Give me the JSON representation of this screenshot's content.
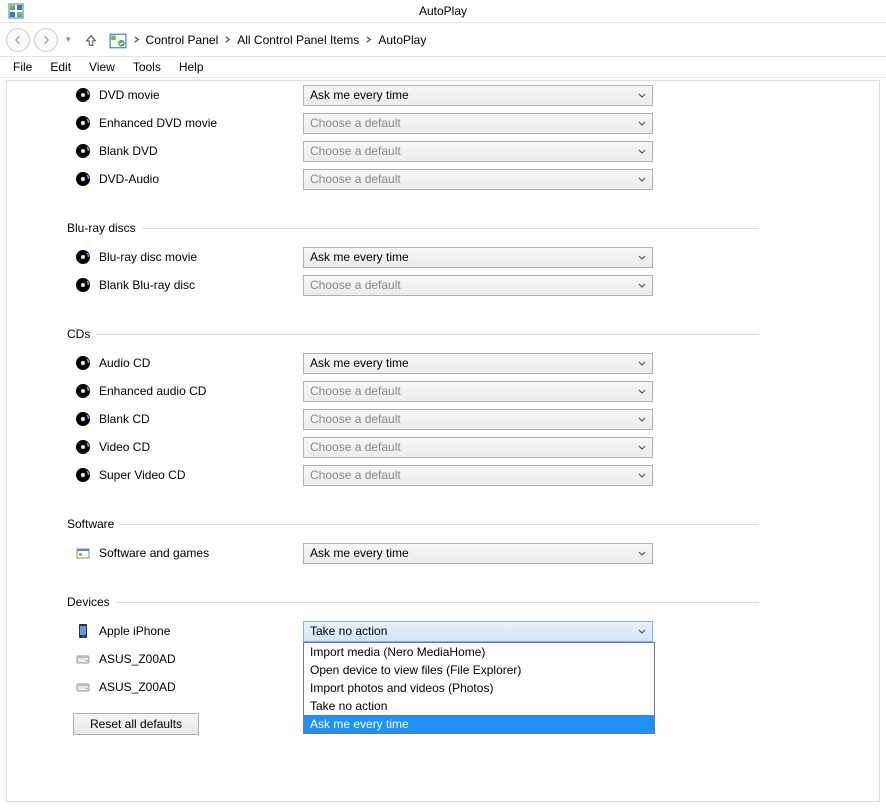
{
  "window": {
    "title": "AutoPlay"
  },
  "breadcrumb": [
    "Control Panel",
    "All Control Panel Items",
    "AutoPlay"
  ],
  "menus": [
    "File",
    "Edit",
    "View",
    "Tools",
    "Help"
  ],
  "dropdown_values": {
    "ask": "Ask me every time",
    "choose": "Choose a default",
    "take_none": "Take no action"
  },
  "sections": [
    {
      "title": null,
      "items": [
        {
          "label": "DVD movie",
          "value": "ask",
          "enabled": true,
          "icon": "disc"
        },
        {
          "label": "Enhanced DVD movie",
          "value": "choose",
          "enabled": false,
          "icon": "disc"
        },
        {
          "label": "Blank DVD",
          "value": "choose",
          "enabled": false,
          "icon": "disc"
        },
        {
          "label": "DVD-Audio",
          "value": "choose",
          "enabled": false,
          "icon": "disc"
        }
      ]
    },
    {
      "title": "Blu-ray discs",
      "items": [
        {
          "label": "Blu-ray disc movie",
          "value": "ask",
          "enabled": true,
          "icon": "disc"
        },
        {
          "label": "Blank Blu-ray disc",
          "value": "choose",
          "enabled": false,
          "icon": "disc"
        }
      ]
    },
    {
      "title": "CDs",
      "items": [
        {
          "label": "Audio CD",
          "value": "ask",
          "enabled": true,
          "icon": "disc"
        },
        {
          "label": "Enhanced audio CD",
          "value": "choose",
          "enabled": false,
          "icon": "disc"
        },
        {
          "label": "Blank CD",
          "value": "choose",
          "enabled": false,
          "icon": "disc"
        },
        {
          "label": "Video CD",
          "value": "choose",
          "enabled": false,
          "icon": "disc"
        },
        {
          "label": "Super Video CD",
          "value": "choose",
          "enabled": false,
          "icon": "disc"
        }
      ]
    },
    {
      "title": "Software",
      "items": [
        {
          "label": "Software and games",
          "value": "ask",
          "enabled": true,
          "icon": "software"
        }
      ]
    },
    {
      "title": "Devices",
      "items": [
        {
          "label": "Apple iPhone",
          "value": "take_none",
          "enabled": true,
          "icon": "phone",
          "open": true
        },
        {
          "label": "ASUS_Z00AD",
          "value": null,
          "enabled": true,
          "icon": "drive"
        },
        {
          "label": "ASUS_Z00AD",
          "value": null,
          "enabled": true,
          "icon": "drive"
        }
      ]
    }
  ],
  "open_dropdown_options": [
    "Import media (Nero MediaHome)",
    "Open device to view files (File Explorer)",
    "Import photos and videos (Photos)",
    "Take no action",
    "Ask me every time"
  ],
  "open_dropdown_selected_index": 4,
  "reset_label": "Reset all defaults"
}
